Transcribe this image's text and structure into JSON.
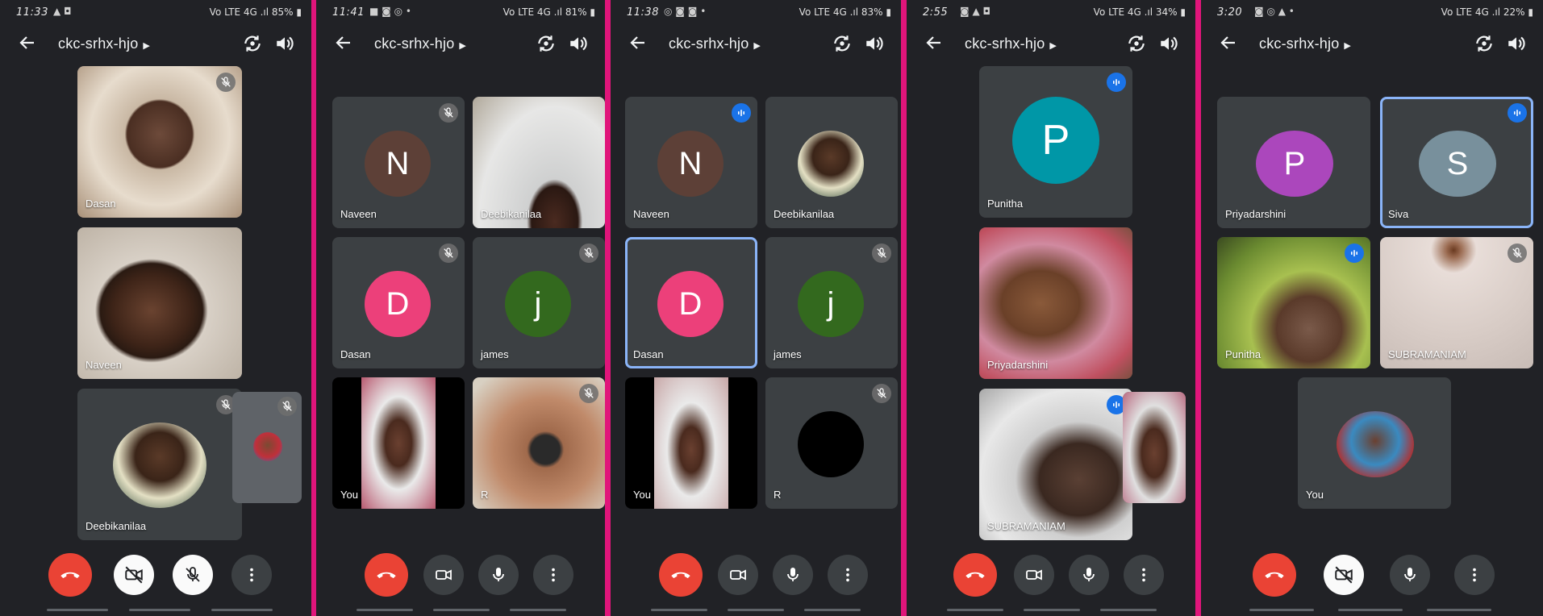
{
  "colors": {
    "separator": "#e0157a",
    "screen_bg": "#212226",
    "tile_bg": "#3c4043",
    "end_call": "#ea4335",
    "speaking": "#1a73e8",
    "active_border": "#8ab4f8"
  },
  "screens": [
    {
      "status_time": "11:33",
      "status_indicators": "▲ ◘",
      "status_right": "Vo LTE 4G .ıl 85% ▮",
      "meeting_code": "ckc-srhx-hjo",
      "tiles": [
        {
          "name": "Dasan"
        },
        {
          "name": "Naveen"
        },
        {
          "name": "Deebikanilaa"
        }
      ]
    },
    {
      "status_time": "11:41",
      "status_indicators": "■ ◙ ◎ •",
      "status_right": "Vo LTE 4G .ıl 81% ▮",
      "meeting_code": "ckc-srhx-hjo",
      "tiles": [
        {
          "name": "Naveen",
          "initial": "N",
          "color": "#5d4037"
        },
        {
          "name": "Deebikanilaa"
        },
        {
          "name": "Dasan",
          "initial": "D",
          "color": "#ec407a"
        },
        {
          "name": "james",
          "initial": "j",
          "color": "#33691e"
        },
        {
          "name": "You"
        },
        {
          "name": "R"
        }
      ]
    },
    {
      "status_time": "11:38",
      "status_indicators": "◎ ◙ ◙ •",
      "status_right": "Vo LTE 4G .ıl 83% ▮",
      "meeting_code": "ckc-srhx-hjo",
      "tiles": [
        {
          "name": "Naveen",
          "initial": "N",
          "color": "#5d4037"
        },
        {
          "name": "Deebikanilaa"
        },
        {
          "name": "Dasan",
          "initial": "D",
          "color": "#ec407a"
        },
        {
          "name": "james",
          "initial": "j",
          "color": "#33691e"
        },
        {
          "name": "You"
        },
        {
          "name": "R"
        }
      ]
    },
    {
      "status_time": "2:55",
      "status_indicators": "◙ ▲ ◘",
      "status_right": "Vo LTE 4G .ıl 34% ▮",
      "meeting_code": "ckc-srhx-hjo",
      "tiles": [
        {
          "name": "Punitha",
          "initial": "P",
          "color": "#0097a7"
        },
        {
          "name": "Priyadarshini"
        },
        {
          "name": "SUBRAMANIAM"
        }
      ]
    },
    {
      "status_time": "3:20",
      "status_indicators": "◙ ◎ ▲ •",
      "status_right": "Vo LTE 4G .ıl 22% ▮",
      "meeting_code": "ckc-srhx-hjo",
      "tiles": [
        {
          "name": "Priyadarshini",
          "initial": "P",
          "color": "#ab47bc"
        },
        {
          "name": "Siva",
          "initial": "S",
          "color": "#78909c"
        },
        {
          "name": "Punitha"
        },
        {
          "name": "SUBRAMANIAM"
        },
        {
          "name": "You"
        }
      ]
    }
  ],
  "icons": {
    "back": "arrow-left-icon",
    "switch_camera": "switch-camera-icon",
    "speaker": "speaker-icon",
    "end_call": "end-call-icon",
    "camera": "camera-icon",
    "camera_off": "camera-off-icon",
    "mic": "mic-icon",
    "mic_off": "mic-off-icon",
    "more": "more-vert-icon"
  }
}
